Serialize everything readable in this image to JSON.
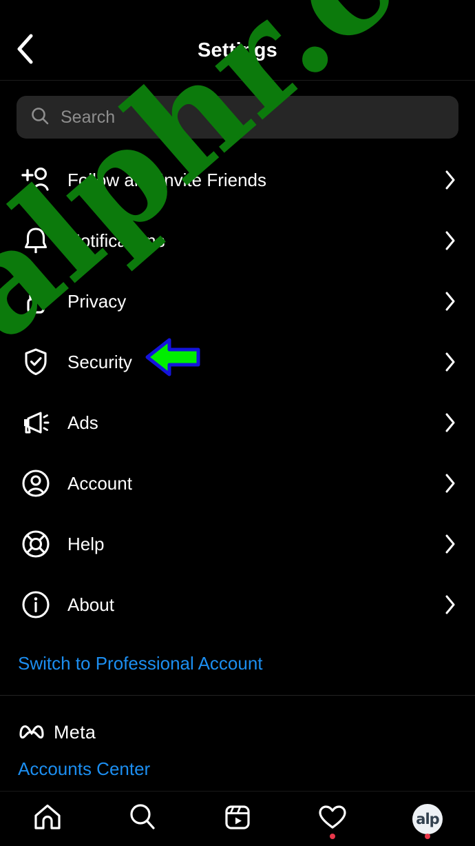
{
  "app": {
    "platform": "instagram-mobile",
    "theme": "dark"
  },
  "header": {
    "title": "Settings",
    "back_icon": "chevron-left-icon"
  },
  "search": {
    "placeholder": "Search",
    "value": "",
    "icon": "search-icon"
  },
  "menu": {
    "items": [
      {
        "label": "Follow and Invite Friends",
        "icon": "person-add-icon",
        "chevron": "chevron-right-icon"
      },
      {
        "label": "Notifications",
        "icon": "bell-icon",
        "chevron": "chevron-right-icon"
      },
      {
        "label": "Privacy",
        "icon": "lock-icon",
        "chevron": "chevron-right-icon"
      },
      {
        "label": "Security",
        "icon": "shield-check-icon",
        "chevron": "chevron-right-icon"
      },
      {
        "label": "Ads",
        "icon": "megaphone-icon",
        "chevron": "chevron-right-icon"
      },
      {
        "label": "Account",
        "icon": "person-circle-icon",
        "chevron": "chevron-right-icon"
      },
      {
        "label": "Help",
        "icon": "lifebuoy-icon",
        "chevron": "chevron-right-icon"
      },
      {
        "label": "About",
        "icon": "info-circle-icon",
        "chevron": "chevron-right-icon"
      }
    ]
  },
  "switch_account": {
    "label": "Switch to Professional Account"
  },
  "meta": {
    "brand": "Meta",
    "logo_icon": "meta-infinity-icon",
    "accounts_center_label": "Accounts Center"
  },
  "tabbar": {
    "items": [
      {
        "name": "home",
        "icon": "home-icon",
        "badge": false
      },
      {
        "name": "search",
        "icon": "search-icon",
        "badge": false
      },
      {
        "name": "reels",
        "icon": "reels-icon",
        "badge": false
      },
      {
        "name": "activity",
        "icon": "heart-icon",
        "badge": true
      },
      {
        "name": "profile",
        "icon": "avatar-icon",
        "badge": true,
        "avatar_text": "alp"
      }
    ]
  },
  "annotation": {
    "arrow": {
      "icon": "left-arrow-annotation-icon",
      "points_to": "Security",
      "fill_color": "#00ee00",
      "outline_color": "#1414dc"
    }
  },
  "watermark": {
    "text": "alphr.com",
    "color": "#0c7a0c"
  },
  "colors": {
    "background": "#000000",
    "search_field": "#262626",
    "link_blue": "#1c8ef0",
    "divider": "#232323",
    "badge_red": "#e8374a",
    "text_primary": "#ffffff",
    "text_placeholder": "#8e8e8e"
  }
}
